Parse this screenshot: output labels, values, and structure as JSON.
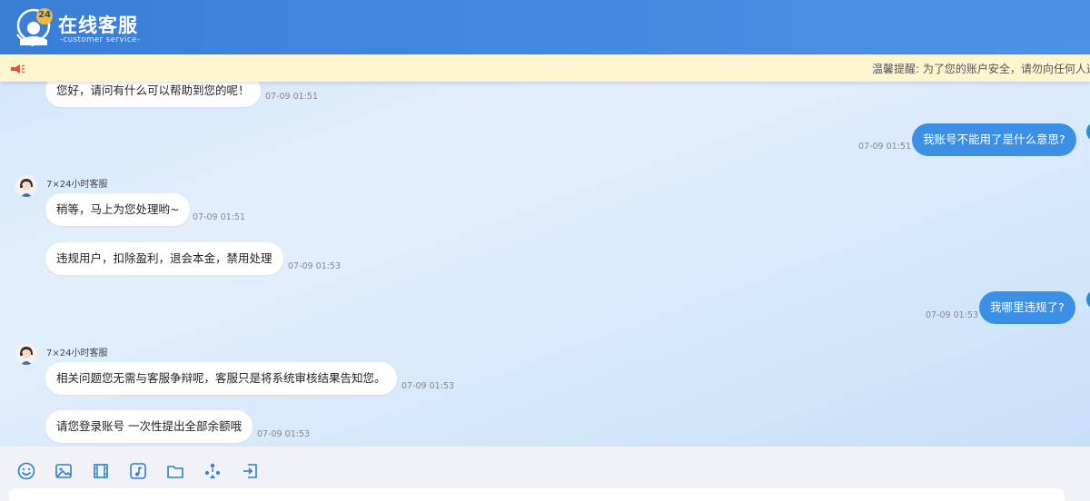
{
  "header": {
    "title": "在线客服",
    "subtitle": "-customer service-",
    "logo_badge": "24"
  },
  "notice": {
    "text": "温馨提醒: 为了您的账户安全，请勿向任何人透露"
  },
  "messages": [
    {
      "side": "left",
      "text": "您好，请问有什么可以帮助到您的呢！",
      "time": "07-09 01:51"
    },
    {
      "side": "right",
      "text": "我账号不能用了是什么意思?",
      "time": "07-09 01:51"
    },
    {
      "side": "left",
      "sender": "7×24小时客服",
      "text": "稍等，马上为您处理哟~",
      "time": "07-09 01:51"
    },
    {
      "side": "left",
      "text": "违规用户，扣除盈利，退会本金，禁用处理",
      "time": "07-09 01:53"
    },
    {
      "side": "right",
      "text": "我哪里违规了?",
      "time": "07-09 01:53"
    },
    {
      "side": "left",
      "sender": "7×24小时客服",
      "text": "相关问题您无需与客服争辩呢，客服只是将系统审核结果告知您。",
      "time": "07-09 01:53"
    },
    {
      "side": "left",
      "text": "请您登录账号 一次性提出全部余额哦",
      "time": "07-09 01:53"
    }
  ],
  "toolbar": {
    "icons": [
      "emoji-icon",
      "image-icon",
      "video-icon",
      "music-icon",
      "folder-icon",
      "transfer-agent-icon",
      "exit-icon"
    ]
  },
  "colors": {
    "header": "#3f88e0",
    "notice_bg": "#fdf5cf",
    "right_bubble": "#3b8fe4",
    "left_bubble": "#ffffff"
  }
}
